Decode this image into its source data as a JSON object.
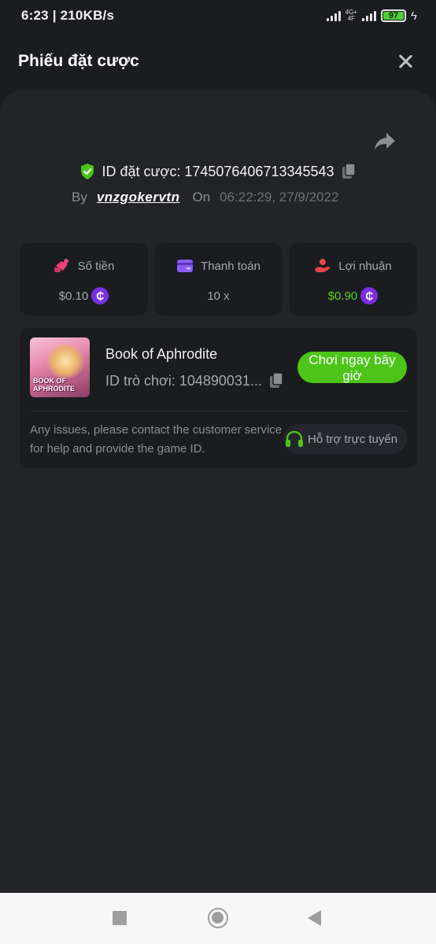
{
  "status_bar": {
    "time_speed": "6:23 | 210KB/s",
    "network_tag_top": "4G+",
    "network_tag_bottom": "4F",
    "battery": "97"
  },
  "header": {
    "title": "Phiếu đặt cược"
  },
  "bet": {
    "id_text": "ID đặt cược: 1745076406713345543",
    "by_label": "By",
    "username": "vnzgokervtn",
    "on_label": "On",
    "datetime": "06:22:29, 27/9/2022"
  },
  "stats": [
    {
      "label": "Số tiền",
      "value": "$0.10",
      "icon": "money-hand-icon",
      "icon_color": "#e8457a"
    },
    {
      "label": "Thanh toán",
      "value": "10 x",
      "icon": "credit-card-icon",
      "icon_color": "#8b5cf6"
    },
    {
      "label": "Lợi nhuận",
      "value": "$0.90",
      "icon": "profit-hand-icon",
      "icon_color": "#e84545"
    }
  ],
  "coin_symbol": "₵",
  "game": {
    "thumb_text": "BOOK OF\nAPHRODITE",
    "name": "Book of Aphrodite",
    "id_text": "ID trò chơi: 104890031...",
    "play_label": "Chơi ngay bây giờ",
    "help_text": "Any issues, please contact the customer service for help and provide the game ID.",
    "support_label": "Hỗ trợ trực tuyến"
  },
  "colors": {
    "accent_green": "#4cc418",
    "profit_green": "#58d11f",
    "coin_purple": "#7b2fe0",
    "background": "#1b1c20",
    "sheet": "#232428"
  }
}
